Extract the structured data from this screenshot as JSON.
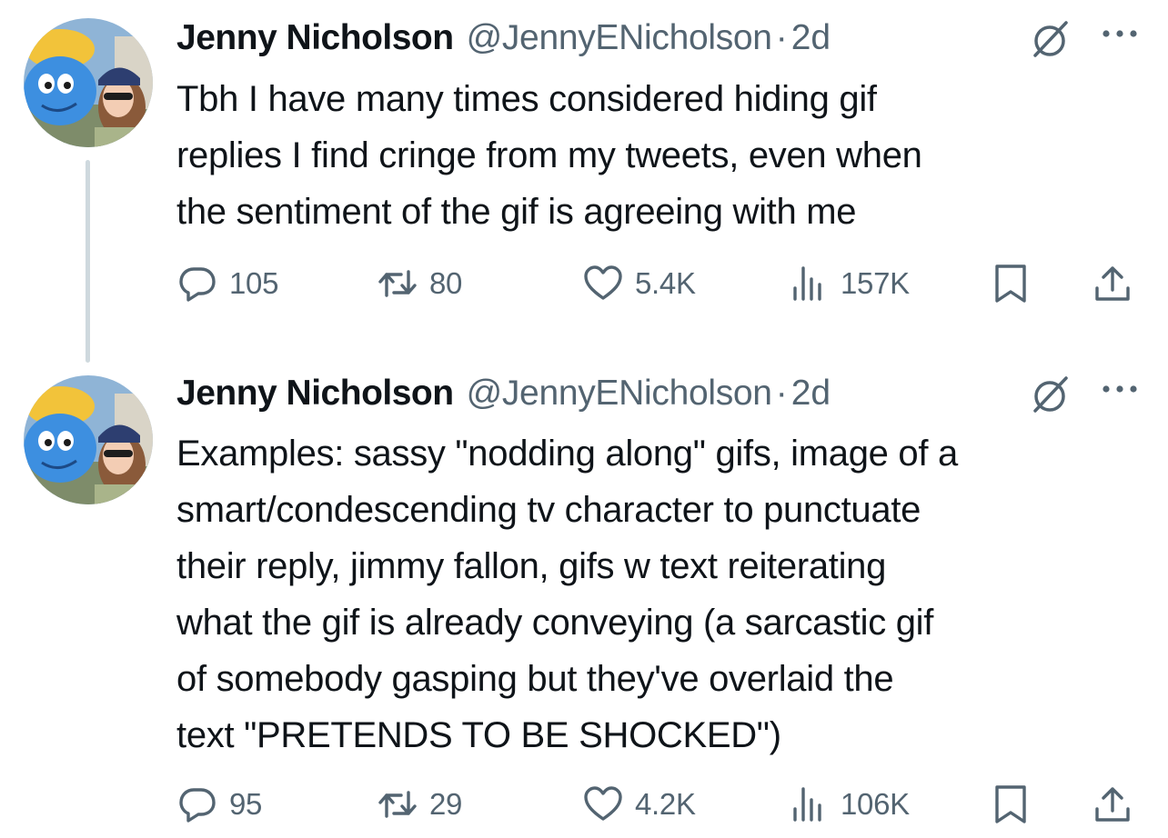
{
  "colors": {
    "text": "#0f1419",
    "secondary": "#536471",
    "thread_line": "#cfd9de",
    "background": "#ffffff"
  },
  "tweets": [
    {
      "author_name": "Jenny Nicholson",
      "handle": "@JennyENicholson",
      "separator": "·",
      "time": "2d",
      "text_lines": [
        "Tbh I have many times considered hiding gif",
        "replies I find cringe from my tweets, even when",
        "the sentiment of the gif is agreeing with me"
      ],
      "replies": "105",
      "retweets": "80",
      "likes": "5.4K",
      "views": "157K"
    },
    {
      "author_name": "Jenny Nicholson",
      "handle": "@JennyENicholson",
      "separator": "·",
      "time": "2d",
      "text_lines": [
        "Examples: sassy \"nodding along\" gifs, image of a",
        "smart/condescending tv character to punctuate",
        "their reply, jimmy fallon, gifs w text reiterating",
        "what the gif is already conveying (a sarcastic gif",
        "of somebody gasping but they've overlaid the",
        "text \"PRETENDS TO BE SHOCKED\")"
      ],
      "replies": "95",
      "retweets": "29",
      "likes": "4.2K",
      "views": "106K"
    }
  ],
  "icons": {
    "reply": "reply-icon",
    "retweet": "retweet-icon",
    "like": "heart-icon",
    "views": "views-icon",
    "bookmark": "bookmark-icon",
    "share": "share-icon",
    "mute": "mute-icon",
    "more": "more-icon"
  }
}
